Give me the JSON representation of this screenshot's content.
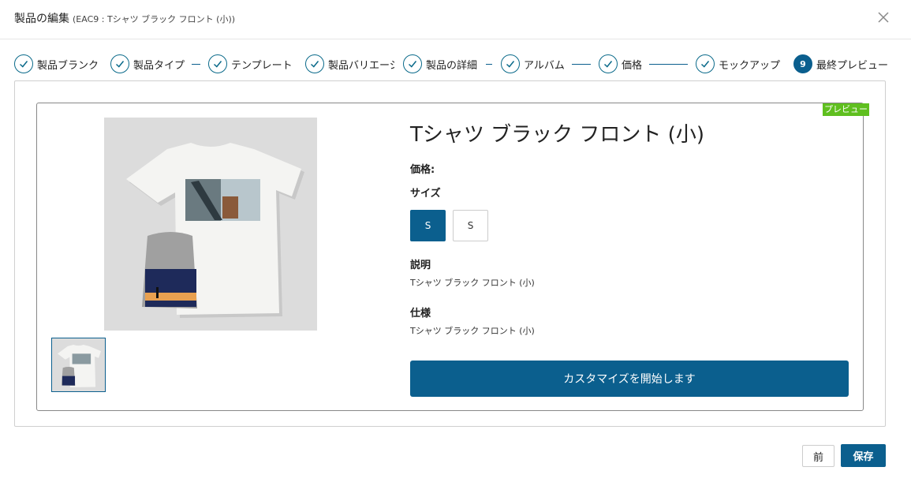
{
  "header": {
    "title": "製品の編集",
    "subtitle": "(EAC9 : Tシャツ ブラック フロント (小))"
  },
  "steps": [
    {
      "label": "製品ブランク",
      "state": "done"
    },
    {
      "label": "製品タイプ",
      "state": "done"
    },
    {
      "label": "テンプレート",
      "state": "done"
    },
    {
      "label": "製品バリエーシ",
      "state": "done"
    },
    {
      "label": "製品の詳細",
      "state": "done"
    },
    {
      "label": "アルバム",
      "state": "done"
    },
    {
      "label": "価格",
      "state": "done"
    },
    {
      "label": "モックアップ",
      "state": "done"
    },
    {
      "label": "最終プレビュー",
      "state": "active",
      "number": "9"
    }
  ],
  "preview": {
    "badge": "プレビュー",
    "product_title": "Tシャツ ブラック フロント (小)",
    "price_label": "価格:",
    "size_label": "サイズ",
    "sizes": [
      "S",
      "S"
    ],
    "selected_size_index": 0,
    "description_label": "説明",
    "description_value": "Tシャツ ブラック フロント (小)",
    "spec_label": "仕様",
    "spec_value": "Tシャツ ブラック フロント (小)",
    "customize_button": "カスタマイズを開始します"
  },
  "footer": {
    "prev_button": "前",
    "save_button": "保存"
  },
  "colors": {
    "primary": "#0b5f8e",
    "badge": "#5fbf1f",
    "check": "#0a6a8a"
  }
}
